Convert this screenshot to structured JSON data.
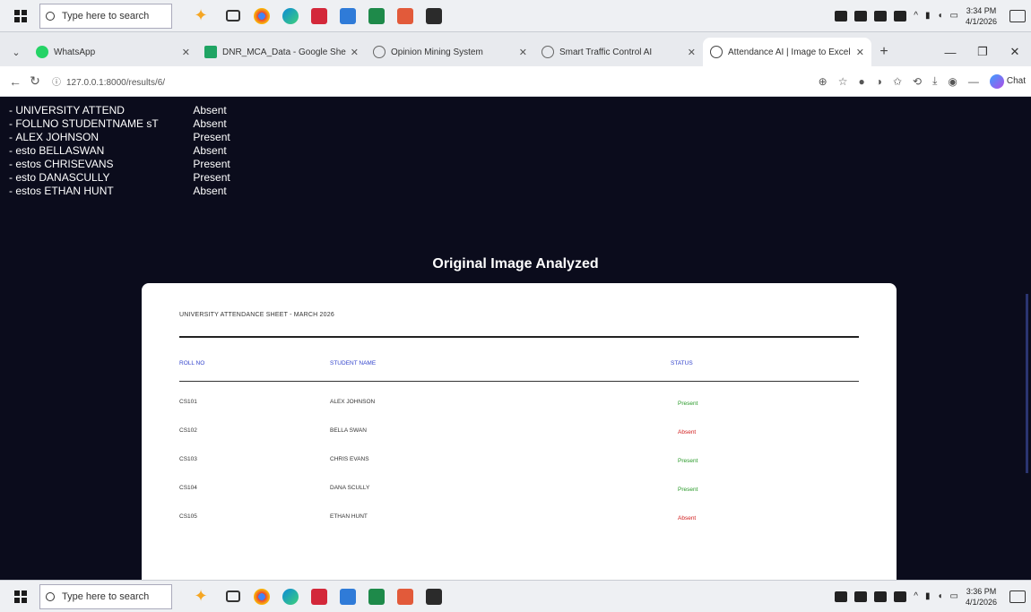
{
  "taskbar": {
    "search_placeholder": "Type here to search",
    "time": "3:34 PM",
    "date": "4/1/2026",
    "time_bottom": "3:36 PM",
    "date_bottom": "4/1/2026"
  },
  "tabs": [
    {
      "label": "WhatsApp",
      "color": "#25d366"
    },
    {
      "label": "DNR_MCA_Data - Google She",
      "color": "#1fa463"
    },
    {
      "label": "Opinion Mining System",
      "color": "#666666"
    },
    {
      "label": "Smart Traffic Control AI",
      "color": "#666666"
    },
    {
      "label": "Attendance AI | Image to Excel",
      "color": "#444444"
    }
  ],
  "address": {
    "url": "127.0.0.1:8000/results/6/"
  },
  "results": [
    {
      "name": "UNIVERSITY ATTEND",
      "status": "Absent"
    },
    {
      "name": "FOLLNO STUDENTNAME sT",
      "status": "Absent"
    },
    {
      "name": "ALEX JOHNSON",
      "status": "Present"
    },
    {
      "name": "esto BELLASWAN",
      "status": "Absent"
    },
    {
      "name": "estos CHRISEVANS",
      "status": "Present"
    },
    {
      "name": "esto DANASCULLY",
      "status": "Present"
    },
    {
      "name": "estos ETHAN HUNT",
      "status": "Absent"
    }
  ],
  "section_heading": "Original Image Analyzed",
  "sheet": {
    "title": "UNIVERSITY ATTENDANCE SHEET - MARCH 2026",
    "headers": {
      "roll": "ROLL NO",
      "name": "STUDENT NAME",
      "status": "STATUS"
    },
    "rows": [
      {
        "roll": "CS101",
        "name": "ALEX JOHNSON",
        "status": "Present"
      },
      {
        "roll": "CS102",
        "name": "BELLA SWAN",
        "status": "Absent"
      },
      {
        "roll": "CS103",
        "name": "CHRIS EVANS",
        "status": "Present"
      },
      {
        "roll": "CS104",
        "name": "DANA SCULLY",
        "status": "Present"
      },
      {
        "roll": "CS105",
        "name": "ETHAN HUNT",
        "status": "Absent"
      }
    ]
  },
  "chat_label": "Chat"
}
